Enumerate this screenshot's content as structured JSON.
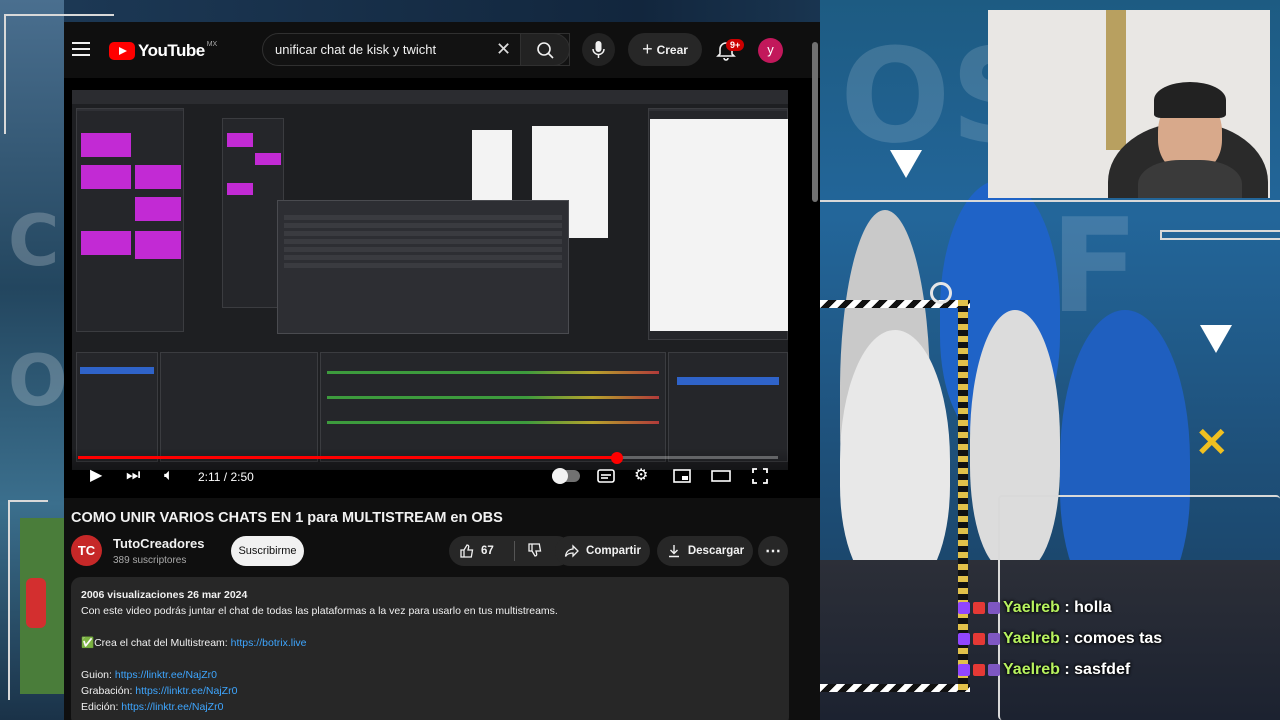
{
  "header": {
    "logo_text": "YouTube",
    "logo_country": "MX",
    "search_value": "unificar chat de kisk y twicht",
    "create_label": "Crear",
    "notifications_badge": "9+",
    "avatar_letter": "y"
  },
  "player": {
    "time_display": "2:11 / 2:50",
    "progress_fraction": 0.77
  },
  "video": {
    "title": "COMO UNIR VARIOS CHATS EN 1 para MULTISTREAM en OBS",
    "channel_name": "TutoCreadores",
    "channel_avatar_text": "TC",
    "subscribers": "389 suscriptores",
    "subscribe_label": "Suscribirme",
    "likes": "67",
    "share_label": "Compartir",
    "download_label": "Descargar"
  },
  "description": {
    "stats": "2006 visualizaciones  26 mar 2024",
    "line1": "Con este video podrás juntar el chat de todas las plataformas a la vez para usarlo en tus multistreams.",
    "line2_prefix": "✅Crea el chat del Multistream: ",
    "line2_link": "https://botrix.live",
    "guion_label": "Guion: ",
    "guion_link": "https://linktr.ee/NajZr0",
    "grabacion_label": "Grabación: ",
    "grabacion_link": "https://linktr.ee/NajZr0",
    "edicion_label": "Edición: ",
    "edicion_link": "https://linktr.ee/NajZr0"
  },
  "stream_chat": [
    {
      "user": "Yaelreb",
      "message": "holla"
    },
    {
      "user": "Yaelreb",
      "message": "comoes tas"
    },
    {
      "user": "Yaelreb",
      "message": "sasfdef"
    }
  ],
  "colors": {
    "youtube_red": "#ff0000",
    "link_blue": "#3ea6ff",
    "chat_user_green": "#b7f25f",
    "obs_magenta": "#c22ad4"
  }
}
